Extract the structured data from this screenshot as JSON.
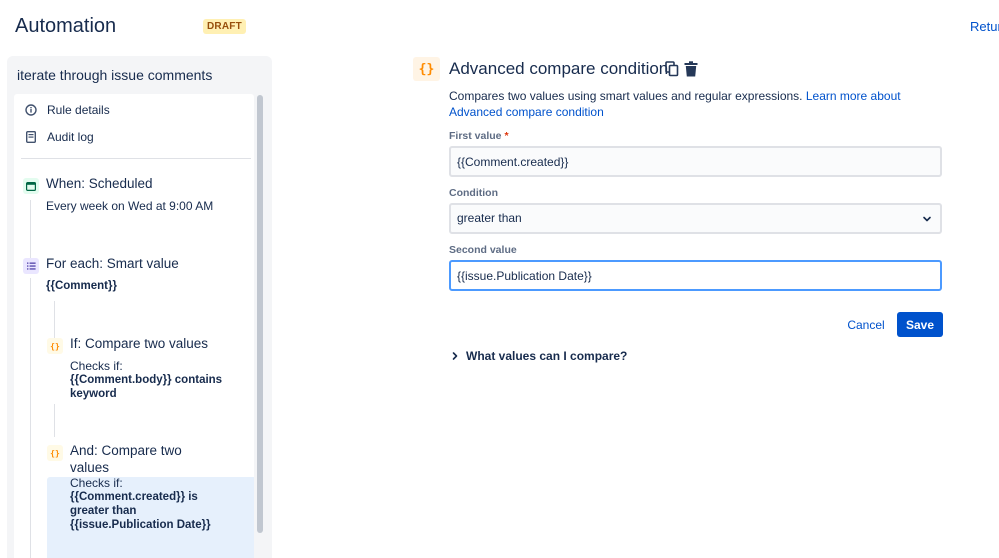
{
  "header": {
    "title": "Automation",
    "draft_badge": "DRAFT",
    "return_link": "Retur"
  },
  "sidebar": {
    "rule_name": "iterate through issue comments",
    "nav": [
      {
        "label": "Rule details",
        "icon": "info-icon"
      },
      {
        "label": "Audit log",
        "icon": "document-icon"
      }
    ],
    "trigger": {
      "title": "When: Scheduled",
      "detail": "Every week on Wed at 9:00 AM",
      "icon": "calendar-icon"
    },
    "branch": {
      "title": "For each: Smart value",
      "value": "{{Comment}}",
      "icon": "list-icon"
    },
    "condition1": {
      "title": "If: Compare two values",
      "checks": "Checks if:",
      "line1": "{{Comment.body}} contains",
      "line2": "keyword",
      "icon": "curly-braces-icon"
    },
    "condition2": {
      "title_line1": "And: Compare two",
      "title_line2": "values",
      "checks": "Checks if:",
      "line1": "{{Comment.created}} is",
      "line2": "greater than",
      "line3": "{{issue.Publication Date}}",
      "icon": "curly-braces-icon"
    }
  },
  "panel": {
    "icon_glyph": "{}",
    "title": "Advanced compare condition",
    "description": "Compares two values using smart values and regular expressions. ",
    "learn_more": "Learn more about Advanced compare condition",
    "first_value": {
      "label": "First value",
      "required_mark": "*",
      "value": "{{Comment.created}}"
    },
    "condition": {
      "label": "Condition",
      "value": "greater than"
    },
    "second_value": {
      "label": "Second value",
      "value": "{{issue.Publication Date}}"
    },
    "cancel_label": "Cancel",
    "save_label": "Save",
    "expander_label": "What values can I compare?"
  },
  "icons": {
    "glyph": "{}"
  },
  "colors": {
    "primary": "#0052cc",
    "selected_bg": "#e6f0fc",
    "draft_bg": "#fff0b3",
    "condition_icon": "#ff8b00"
  }
}
